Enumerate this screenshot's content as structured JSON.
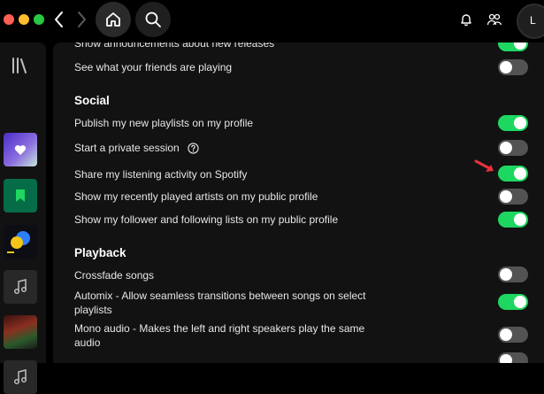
{
  "window": {
    "avatar_initial": "L"
  },
  "sections": {
    "top": {
      "rows": [
        {
          "label": "Show announcements about new releases",
          "enabled": true
        },
        {
          "label": "See what your friends are playing",
          "enabled": false
        }
      ]
    },
    "social": {
      "title": "Social",
      "rows": [
        {
          "label": "Publish my new playlists on my profile",
          "enabled": true
        },
        {
          "label": "Start a private session",
          "enabled": false,
          "icon": "help-icon"
        },
        {
          "label": "Share my listening activity on Spotify",
          "enabled": true
        },
        {
          "label": "Show my recently played artists on my public profile",
          "enabled": false
        },
        {
          "label": "Show my follower and following lists on my public profile",
          "enabled": true
        }
      ]
    },
    "playback": {
      "title": "Playback",
      "rows": [
        {
          "label": "Crossfade songs",
          "enabled": false
        },
        {
          "label": "Automix - Allow seamless transitions between songs on select playlists",
          "enabled": true
        },
        {
          "label": "Mono audio - Makes the left and right speakers play the same audio",
          "enabled": false
        }
      ]
    }
  },
  "colors": {
    "accent": "#1ed760",
    "toggle_off": "#535353",
    "annotation_arrow": "#e8323c"
  },
  "icons": [
    "back-icon",
    "forward-icon",
    "home-icon",
    "search-icon",
    "bell-icon",
    "friends-icon",
    "library-icon",
    "heart-icon",
    "bookmark-icon",
    "music-note-icon",
    "help-icon",
    "annotation-arrow-icon"
  ]
}
